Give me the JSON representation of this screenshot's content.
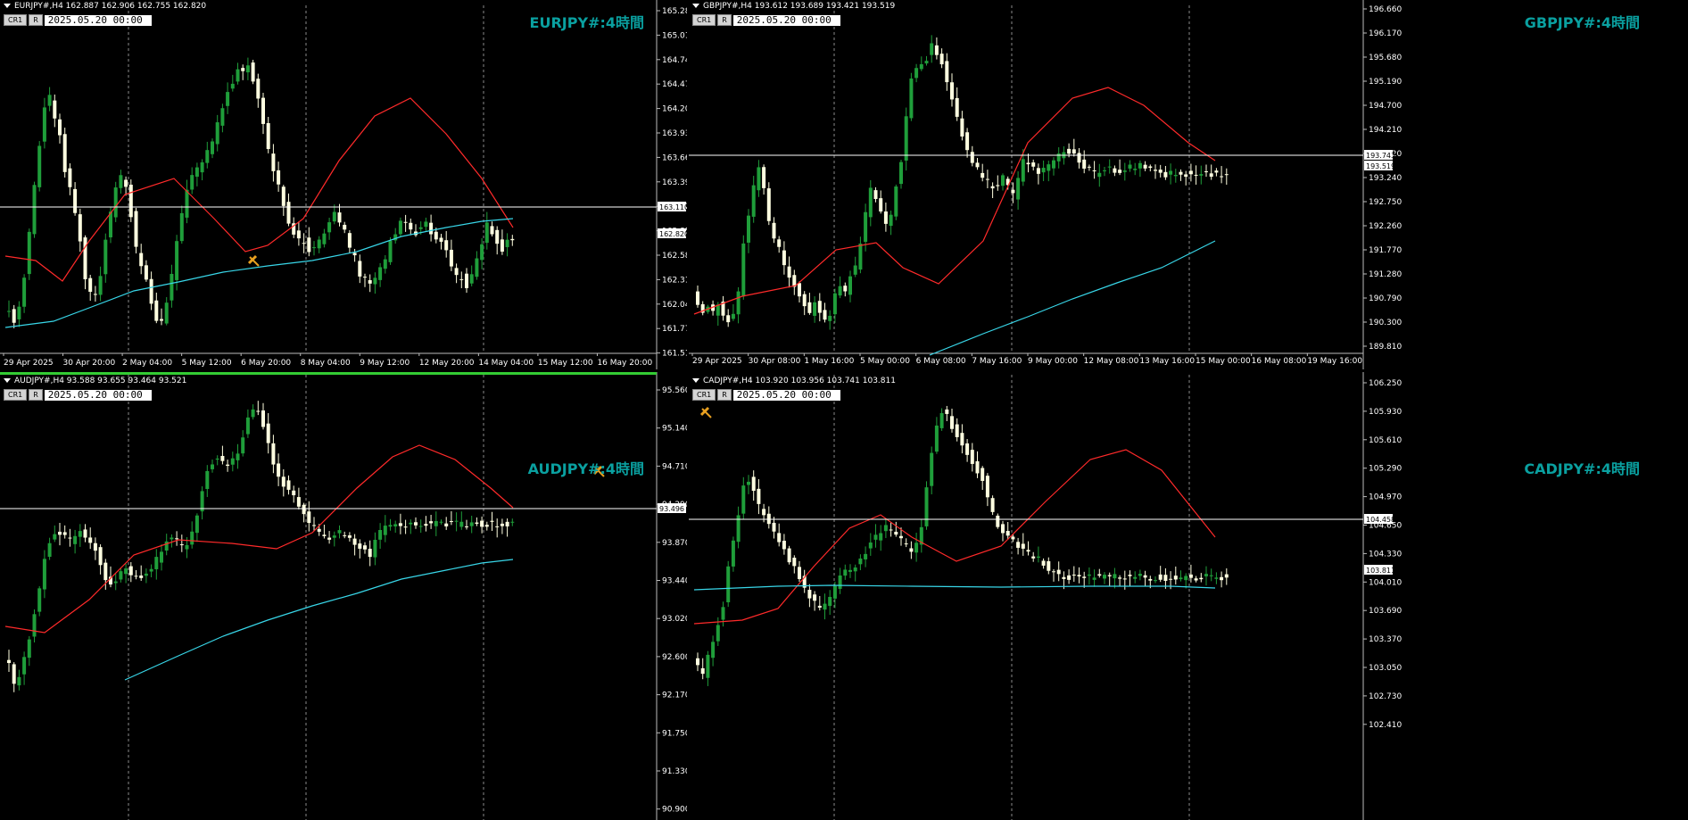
{
  "colors": {
    "background": "#000000",
    "bull": "#1f9e3a",
    "bear": "#ffffe0",
    "ma_fast": "#ff2a2a",
    "ma_slow": "#38d6e8",
    "symbol_label": "#0aa0a0",
    "active_border": "#33cc33"
  },
  "common": {
    "cr1_label": "CR1",
    "r_label": "R",
    "date_value": "2025.05.20 00:00"
  },
  "panels": [
    {
      "id": "eurjpy",
      "header": "EURJPY#,H4  162.887 162.906 162.755 162.820",
      "symbol_label": "EURJPY#:4時間",
      "price_ticks": [
        "165.280",
        "165.010",
        "164.740",
        "164.470",
        "164.200",
        "163.930",
        "163.665",
        "163.395",
        "163.125",
        "162.855",
        "162.585",
        "162.315",
        "162.045",
        "161.775",
        "161.510"
      ],
      "time_labels": [
        "29 Apr 2025",
        "30 Apr 20:00",
        "2 May 04:00",
        "5 May 12:00",
        "6 May 20:00",
        "8 May 04:00",
        "9 May 12:00",
        "12 May 20:00",
        "14 May 04:00",
        "15 May 12:00",
        "16 May 20:00"
      ],
      "hline_label": "163.110",
      "current_label": "162.820",
      "drawing_icon": "hammer-icon"
    },
    {
      "id": "gbpjpy",
      "header": "GBPJPY#,H4  193.612 193.689 193.421 193.519",
      "symbol_label": "GBPJPY#:4時間",
      "price_ticks": [
        "196.660",
        "196.170",
        "195.680",
        "195.190",
        "194.700",
        "194.210",
        "193.720",
        "193.240",
        "192.750",
        "192.260",
        "191.770",
        "191.280",
        "190.790",
        "190.300",
        "189.810"
      ],
      "time_labels": [
        "29 Apr 2025",
        "30 Apr 08:00",
        "1 May 16:00",
        "5 May 00:00",
        "6 May 08:00",
        "7 May 16:00",
        "9 May 00:00",
        "12 May 08:00",
        "13 May 16:00",
        "15 May 00:00",
        "16 May 08:00",
        "19 May 16:00"
      ],
      "hline_label": "193.743",
      "current_label": "193.519"
    },
    {
      "id": "audjpy",
      "header": "AUDJPY#,H4  93.588 93.655 93.464 93.521",
      "symbol_label": "AUDJPY#:4時間",
      "price_ticks": [
        "95.560",
        "95.140",
        "94.710",
        "94.290",
        "93.870",
        "93.440",
        "93.020",
        "92.600",
        "92.170",
        "91.750",
        "91.330",
        "90.900"
      ],
      "time_labels": [],
      "hline_label": "93.496",
      "current_label": "",
      "drawing_icon": "hammer-icon"
    },
    {
      "id": "cadjpy",
      "header": "CADJPY#,H4  103.920 103.956 103.741 103.811",
      "symbol_label": "CADJPY#:4時間",
      "price_ticks": [
        "106.250",
        "105.930",
        "105.610",
        "105.290",
        "104.970",
        "104.650",
        "104.330",
        "104.010",
        "103.690",
        "103.370",
        "103.050",
        "102.730",
        "102.410"
      ],
      "time_labels": [],
      "hline_label": "104.458",
      "current_label": "103.811",
      "drawing_icon": "hammer-icon"
    }
  ]
}
